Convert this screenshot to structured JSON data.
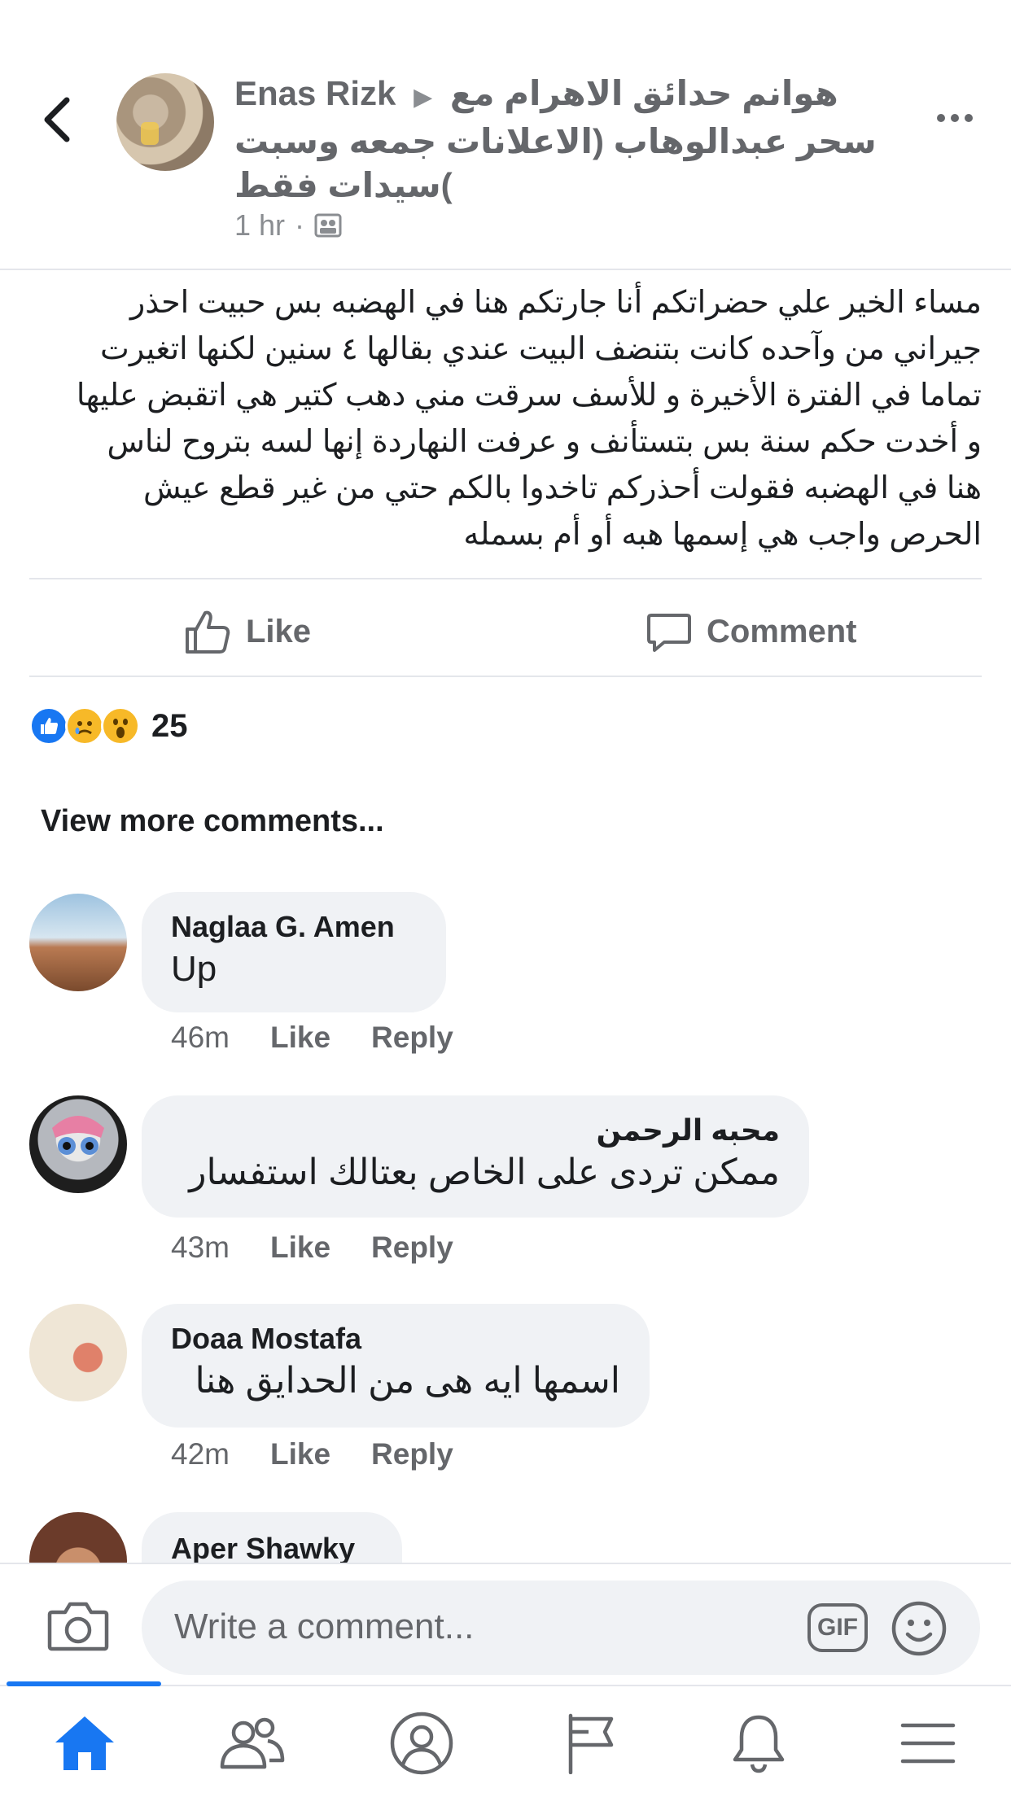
{
  "post": {
    "author": "Enas Rizk",
    "group": "هوانم حدائق الاهرام  مع سحر عبدالوهاب (الاعلانات جمعه وسبت )سيدات فقط",
    "time": "1 hr",
    "time_separator": "·",
    "body_lines": [
      "مساء الخير علي حضراتكم أنا جارتكم هنا في الهضبه بس حبيت احذر",
      "جيراني من وآحده كانت بتنضف البيت عندي بقالها ٤ سنين لكنها اتغيرت",
      "تماما في الفترة الأخيرة و للأسف سرقت مني دهب كتير هي اتقبض عليها",
      "و أخدت حكم سنة بس بتستأنف و عرفت النهاردة إنها لسه بتروح لناس",
      "هنا في الهضبه فقولت أحذركم تاخدوا بالكم حتي من غير قطع عيش",
      "الحرص واجب هي إسمها هبه أو أم بسمله"
    ]
  },
  "actions": {
    "like_label": "Like",
    "comment_label": "Comment"
  },
  "reactions": {
    "count": "25",
    "types": [
      "like-icon",
      "sad-icon",
      "wow-icon"
    ]
  },
  "view_more_label": "View more comments...",
  "comments": [
    {
      "name": "Naglaa G. Amen",
      "text": "Up",
      "time": "46m",
      "like": "Like",
      "reply": "Reply"
    },
    {
      "name": "محبه الرحمن",
      "text": "ممكن تردى على الخاص بعتالك استفسار",
      "time": "43m",
      "like": "Like",
      "reply": "Reply"
    },
    {
      "name": "Doaa Mostafa",
      "text": "اسمها ايه هى من الحدايق هنا",
      "time": "42m",
      "like": "Like",
      "reply": "Reply"
    },
    {
      "name": "Aper Shawky",
      "text": "",
      "time": "",
      "like": "",
      "reply": ""
    }
  ],
  "composer": {
    "placeholder": "Write a comment...",
    "gif_label": "GIF"
  },
  "tabbar": {
    "items": [
      "home-icon",
      "friends-icon",
      "profile-icon",
      "pages-flag-icon",
      "notifications-bell-icon",
      "menu-icon"
    ],
    "active": "home-icon",
    "active_color": "#1877f2",
    "inactive_color": "#65676b"
  }
}
